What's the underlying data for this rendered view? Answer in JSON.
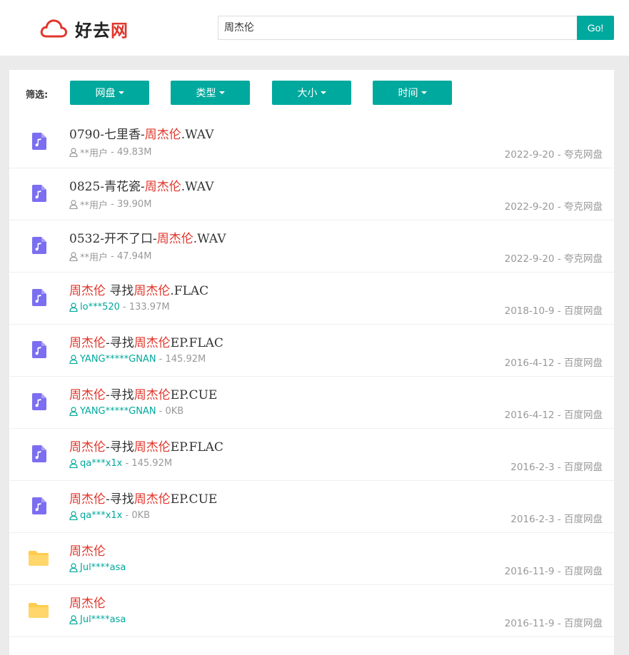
{
  "logo": {
    "text_dark": "好去",
    "text_red": "网"
  },
  "search": {
    "value": "周杰伦",
    "button_label": "Go!"
  },
  "filters": {
    "label": "筛选:",
    "buttons": [
      "网盘",
      "类型",
      "大小",
      "时间"
    ]
  },
  "results": [
    {
      "type": "audio",
      "title_parts": [
        [
          "0790-七里香-",
          false
        ],
        [
          "周杰伦",
          true
        ],
        [
          ".WAV",
          false
        ]
      ],
      "user": "**用户",
      "user_teal": false,
      "size": "49.83M",
      "date": "2022-9-20",
      "source": "夸克网盘"
    },
    {
      "type": "audio",
      "title_parts": [
        [
          "0825-青花瓷-",
          false
        ],
        [
          "周杰伦",
          true
        ],
        [
          ".WAV",
          false
        ]
      ],
      "user": "**用户",
      "user_teal": false,
      "size": "39.90M",
      "date": "2022-9-20",
      "source": "夸克网盘"
    },
    {
      "type": "audio",
      "title_parts": [
        [
          "0532-开不了口-",
          false
        ],
        [
          "周杰伦",
          true
        ],
        [
          ".WAV",
          false
        ]
      ],
      "user": "**用户",
      "user_teal": false,
      "size": "47.94M",
      "date": "2022-9-20",
      "source": "夸克网盘"
    },
    {
      "type": "audio",
      "title_parts": [
        [
          "周杰伦",
          true
        ],
        [
          " 寻找",
          false
        ],
        [
          "周杰伦",
          true
        ],
        [
          ".FLAC",
          false
        ]
      ],
      "user": "lo***520",
      "user_teal": true,
      "size": "133.97M",
      "date": "2018-10-9",
      "source": "百度网盘"
    },
    {
      "type": "audio",
      "title_parts": [
        [
          "周杰伦",
          true
        ],
        [
          "-寻找",
          false
        ],
        [
          "周杰伦",
          true
        ],
        [
          "EP.FLAC",
          false
        ]
      ],
      "user": "YANG*****GNAN",
      "user_teal": true,
      "size": "145.92M",
      "date": "2016-4-12",
      "source": "百度网盘"
    },
    {
      "type": "audio",
      "title_parts": [
        [
          "周杰伦",
          true
        ],
        [
          "-寻找",
          false
        ],
        [
          "周杰伦",
          true
        ],
        [
          "EP.CUE",
          false
        ]
      ],
      "user": "YANG*****GNAN",
      "user_teal": true,
      "size": "0KB",
      "date": "2016-4-12",
      "source": "百度网盘"
    },
    {
      "type": "audio",
      "title_parts": [
        [
          "周杰伦",
          true
        ],
        [
          "-寻找",
          false
        ],
        [
          "周杰伦",
          true
        ],
        [
          "EP.FLAC",
          false
        ]
      ],
      "user": "qa***x1x",
      "user_teal": true,
      "size": "145.92M",
      "date": "2016-2-3",
      "source": "百度网盘"
    },
    {
      "type": "audio",
      "title_parts": [
        [
          "周杰伦",
          true
        ],
        [
          "-寻找",
          false
        ],
        [
          "周杰伦",
          true
        ],
        [
          "EP.CUE",
          false
        ]
      ],
      "user": "qa***x1x",
      "user_teal": true,
      "size": "0KB",
      "date": "2016-2-3",
      "source": "百度网盘"
    },
    {
      "type": "folder",
      "title_parts": [
        [
          "周杰伦",
          true
        ]
      ],
      "user": "Jul****asa",
      "user_teal": true,
      "size": "",
      "date": "2016-11-9",
      "source": "百度网盘"
    },
    {
      "type": "folder",
      "title_parts": [
        [
          "周杰伦",
          true
        ]
      ],
      "user": "Jul****asa",
      "user_teal": true,
      "size": "",
      "date": "2016-11-9",
      "source": "百度网盘"
    }
  ],
  "colors": {
    "accent": "#00a99d",
    "highlight": "#e0362b",
    "audio_icon": "#7b6ef0",
    "folder_icon": "#ffcc4d"
  }
}
